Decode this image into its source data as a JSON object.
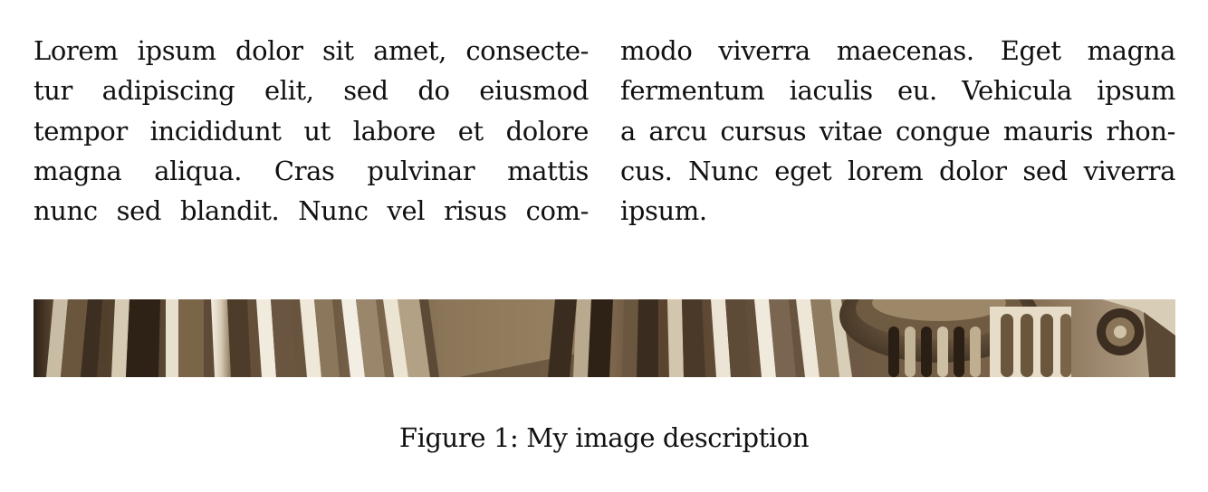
{
  "document": {
    "left_column": {
      "lines": [
        "Lorem ipsum dolor sit amet, consecte-",
        "tur adipiscing elit, sed do eiusmod",
        "tempor incididunt ut labore et dolore",
        "magna aliqua.  Cras pulvinar mattis",
        "nunc sed blandit.  Nunc vel risus com-"
      ]
    },
    "right_column": {
      "lines": [
        "modo viverra maecenas.  Eget magna",
        "fermentum iaculis eu.  Vehicula ipsum",
        "a arcu cursus vitae congue mauris rhon-",
        "cus. Nunc eget lorem dolor sed viverra",
        "ipsum."
      ]
    },
    "figure": {
      "image_subject": "sepia photograph of classical fluted stone columns with ionic capital",
      "caption": "Figure 1:  My image description"
    }
  }
}
